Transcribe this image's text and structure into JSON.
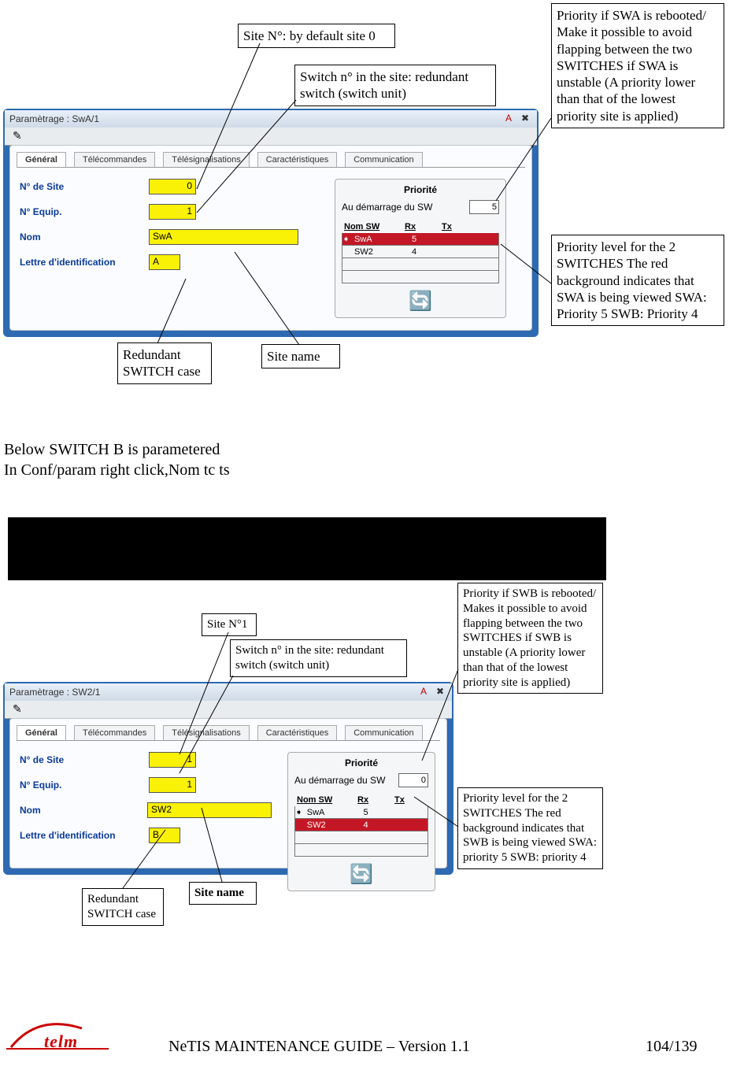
{
  "callouts": {
    "c1": "Site N°: by default site 0",
    "c2": "Switch n° in the site: redundant switch (switch unit)",
    "c3": "Priority if SWA is rebooted/\nMake it possible to avoid flapping between the two SWITCHES if SWA is unstable\n(A priority lower than that of the lowest priority site is applied)",
    "c4": "Priority level for the 2 SWITCHES\nThe red background indicates that SWA is being viewed\nSWA: Priority 5\nSWB: Priority 4",
    "c5": "Redundant SWITCH case",
    "c6": "Site name",
    "c7": "Site N°1",
    "c8": "Switch n° in the site: redundant switch (switch unit)",
    "c9": "Priority if SWB is rebooted/\nMakes it possible to avoid flapping between the two SWITCHES if SWB is unstable\n(A priority lower than that of the lowest priority site is applied)",
    "c10": "Priority level for the 2 SWITCHES\nThe red background indicates that SWB is being viewed\n\nSWA: priority 5\nSWB: priority 4",
    "c11": "Redundant SWITCH case",
    "c12": "Site name"
  },
  "paragraph1": "Below SWITCH B is parametered",
  "paragraph2": "In Conf/param right click,Nom tc ts",
  "footer_title": "NeTIS MAINTENANCE GUIDE – Version 1.1",
  "footer_page": "104/139",
  "logo_brand": "telm",
  "windowA": {
    "title": "Paramètrage : SwA/1",
    "tabs": [
      "Général",
      "Télécommandes",
      "Télésignalisations",
      "Caractéristiques",
      "Communication"
    ],
    "labels": {
      "site": "N° de Site",
      "equip": "N° Equip.",
      "nom": "Nom",
      "lettre": "Lettre d'identification"
    },
    "values": {
      "site": "0",
      "equip": "1",
      "nom": "SwA",
      "lettre": "A"
    },
    "priority": {
      "title": "Priorité",
      "sub": "Au démarrage du SW",
      "sub_value": "5",
      "head_sw": "Nom SW",
      "head_rx": "Rx",
      "head_tx": "Tx",
      "rows": [
        {
          "name": "SwA",
          "rx": "5",
          "tx": "",
          "red": true
        },
        {
          "name": "SW2",
          "rx": "4",
          "tx": "",
          "red": false
        }
      ]
    }
  },
  "windowB": {
    "title": "Paramètrage : SW2/1",
    "tabs": [
      "Général",
      "Télécommandes",
      "Télésignalisations",
      "Caractéristiques",
      "Communication"
    ],
    "labels": {
      "site": "N° de Site",
      "equip": "N° Equip.",
      "nom": "Nom",
      "lettre": "Lettre d'identification"
    },
    "values": {
      "site": "1",
      "equip": "1",
      "nom": "SW2",
      "lettre": "B"
    },
    "priority": {
      "title": "Priorité",
      "sub": "Au démarrage du SW",
      "sub_value": "0",
      "head_sw": "Nom SW",
      "head_rx": "Rx",
      "head_tx": "Tx",
      "rows": [
        {
          "name": "SwA",
          "rx": "5",
          "tx": "",
          "red": false
        },
        {
          "name": "SW2",
          "rx": "4",
          "tx": "",
          "red": true
        }
      ]
    }
  }
}
